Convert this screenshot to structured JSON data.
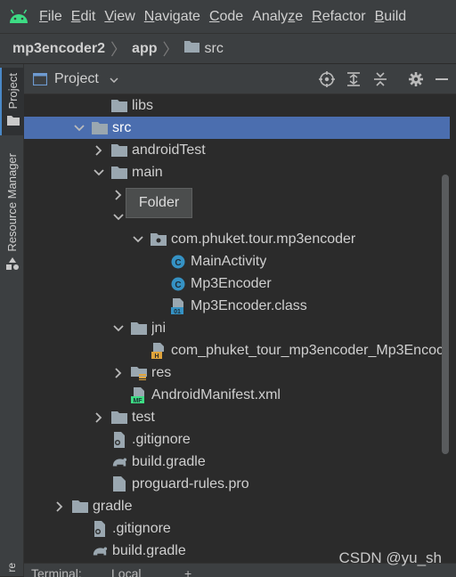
{
  "menubar": {
    "logo_icon": "android-icon",
    "items": [
      {
        "pre": "",
        "mn": "F",
        "post": "ile"
      },
      {
        "pre": "",
        "mn": "E",
        "post": "dit"
      },
      {
        "pre": "",
        "mn": "V",
        "post": "iew"
      },
      {
        "pre": "",
        "mn": "N",
        "post": "avigate"
      },
      {
        "pre": "",
        "mn": "C",
        "post": "ode"
      },
      {
        "pre": "Analy",
        "mn": "z",
        "post": "e"
      },
      {
        "pre": "",
        "mn": "R",
        "post": "efactor"
      },
      {
        "pre": "",
        "mn": "B",
        "post": "uild"
      }
    ]
  },
  "breadcrumb": {
    "project": "mp3encoder2",
    "module": "app",
    "folder": "src"
  },
  "left_stripe": {
    "project_tab": "Project",
    "resource_tab": "Resource Manager"
  },
  "panel": {
    "title": "Project",
    "tools": [
      "locate-icon",
      "expand-all-icon",
      "collapse-all-icon",
      "gear-icon",
      "hide-icon"
    ]
  },
  "tree": {
    "rows": [
      {
        "label": "libs",
        "icon": "folder",
        "arrow": "none",
        "level": 2
      },
      {
        "label": "src",
        "icon": "folder",
        "arrow": "down",
        "level": 1,
        "selected": true
      },
      {
        "label": "androidTest",
        "icon": "folder",
        "arrow": "right",
        "level": 2
      },
      {
        "label": "main",
        "icon": "folder",
        "arrow": "down",
        "level": 2
      },
      {
        "label": "",
        "icon": "none",
        "arrow": "right",
        "level": 3
      },
      {
        "label": "",
        "icon": "none",
        "arrow": "down",
        "level": 3
      },
      {
        "label": "com.phuket.tour.mp3encoder",
        "icon": "package",
        "arrow": "down",
        "level": 4
      },
      {
        "label": "MainActivity",
        "icon": "class",
        "arrow": "none",
        "level": 5
      },
      {
        "label": "Mp3Encoder",
        "icon": "class",
        "arrow": "none",
        "level": 5
      },
      {
        "label": "Mp3Encoder.class",
        "icon": "classfile",
        "arrow": "none",
        "level": 5
      },
      {
        "label": "jni",
        "icon": "folder",
        "arrow": "down",
        "level": 3
      },
      {
        "label": "com_phuket_tour_mp3encoder_Mp3Encoc",
        "icon": "header",
        "arrow": "none",
        "level": 4
      },
      {
        "label": "res",
        "icon": "resfolder",
        "arrow": "right",
        "level": 3
      },
      {
        "label": "AndroidManifest.xml",
        "icon": "manifest",
        "arrow": "none",
        "level": 3
      },
      {
        "label": "test",
        "icon": "folder",
        "arrow": "right",
        "level": 2
      },
      {
        "label": ".gitignore",
        "icon": "gitignore",
        "arrow": "none",
        "level": 2
      },
      {
        "label": "build.gradle",
        "icon": "gradle",
        "arrow": "none",
        "level": 2
      },
      {
        "label": "proguard-rules.pro",
        "icon": "file",
        "arrow": "none",
        "level": 2
      },
      {
        "label": "gradle",
        "icon": "folder",
        "arrow": "right",
        "level": 0
      },
      {
        "label": ".gitignore",
        "icon": "gitignore",
        "arrow": "none",
        "level": 1
      },
      {
        "label": "build.gradle",
        "icon": "gradle",
        "arrow": "none",
        "level": 1
      }
    ]
  },
  "tooltip": {
    "text": "Folder"
  },
  "bottom": {
    "terminal": "Terminal:",
    "local": "Local",
    "plus": "+"
  },
  "watermark": "CSDN @yu_sh",
  "colors": {
    "bg": "#2b2b2b",
    "panel": "#3c3f41",
    "selection": "#4b6eaf",
    "folder": "#9aa7b0",
    "class_icon": "#3592c4",
    "android_green": "#3ddc84"
  }
}
